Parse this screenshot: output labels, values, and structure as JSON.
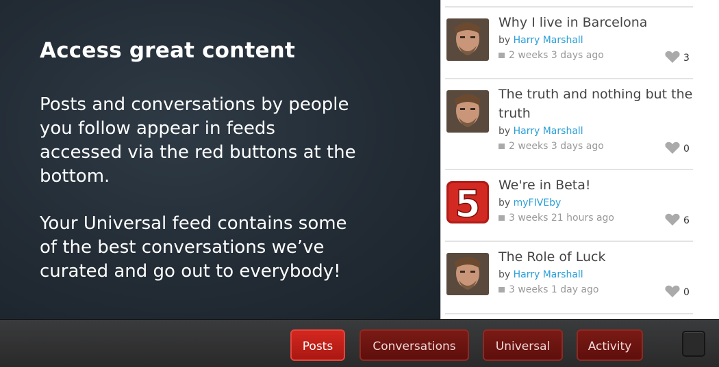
{
  "intro": {
    "headline": "Access great content",
    "paragraph1": "Posts and conversations by people you follow appear in feeds accessed via the red buttons at the bottom.",
    "paragraph2": "Your Universal feed contains some of the best conversations we’ve curated and go out to everybody!"
  },
  "feed": {
    "by_label": "by",
    "items": [
      {
        "title": "Why I live in Barcelona",
        "author": "Harry Marshall",
        "time": "2 weeks 3 days ago",
        "likes": "3",
        "avatar": "person-photo"
      },
      {
        "title": "The truth and nothing but the truth",
        "author": "Harry Marshall",
        "time": "2 weeks 3 days ago",
        "likes": "0",
        "avatar": "person-photo"
      },
      {
        "title": "We're in Beta!",
        "author": "myFIVEby",
        "time": "3 weeks 21 hours ago",
        "likes": "6",
        "avatar": "five-logo"
      },
      {
        "title": "The Role of Luck",
        "author": "Harry Marshall",
        "time": "3 weeks 1 day ago",
        "likes": "0",
        "avatar": "person-photo"
      }
    ],
    "logo_text": "5"
  },
  "nav": {
    "posts": "Posts",
    "conversations": "Conversations",
    "universal": "Universal",
    "activity": "Activity",
    "active": "posts"
  },
  "colors": {
    "author_link": "#2a9fd8",
    "nav_button": "#6b1410",
    "nav_button_active": "#c5211a"
  }
}
